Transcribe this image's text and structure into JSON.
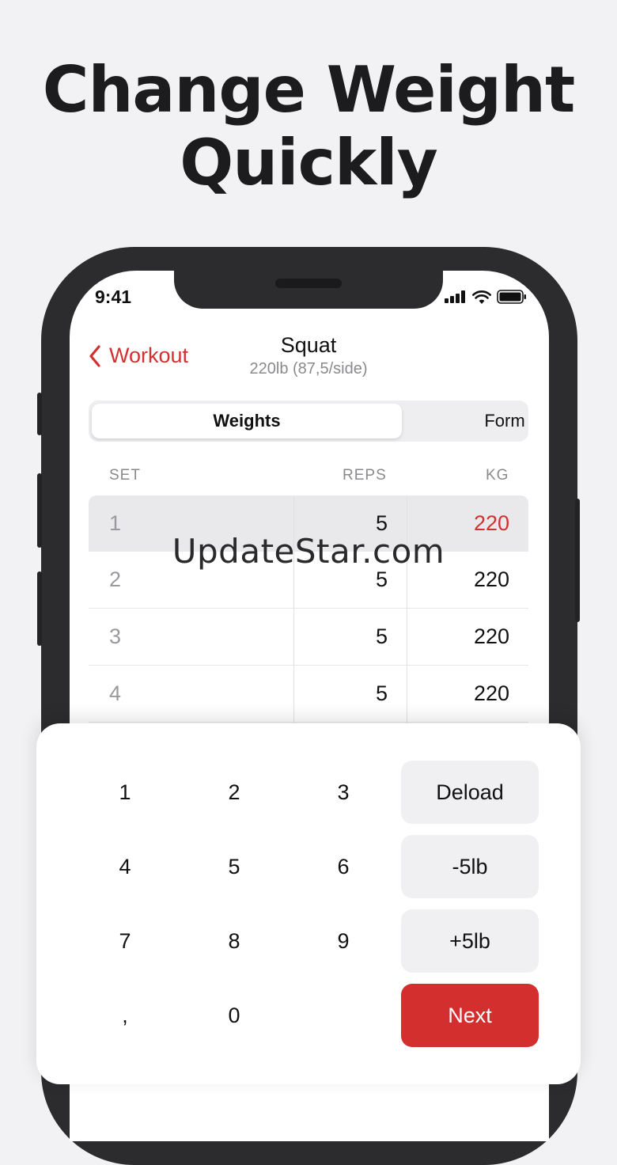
{
  "headline": {
    "line1": "Change Weight",
    "line2": "Quickly"
  },
  "status": {
    "time": "9:41"
  },
  "nav": {
    "back_label": "Workout",
    "title": "Squat",
    "subtitle": "220lb (87,5/side)"
  },
  "tabs": [
    {
      "label": "Weights",
      "selected": true
    },
    {
      "label": "Form",
      "selected": false
    }
  ],
  "table": {
    "headers": {
      "set": "SET",
      "reps": "REPS",
      "kg": "KG"
    },
    "rows": [
      {
        "set": "1",
        "reps": "5",
        "kg": "220",
        "selected": true
      },
      {
        "set": "2",
        "reps": "5",
        "kg": "220"
      },
      {
        "set": "3",
        "reps": "5",
        "kg": "220"
      },
      {
        "set": "4",
        "reps": "5",
        "kg": "220"
      }
    ]
  },
  "watermark": "UpdateStar.com",
  "keypad": {
    "keys": [
      "1",
      "2",
      "3",
      "4",
      "5",
      "6",
      "7",
      "8",
      "9",
      ",",
      "0"
    ],
    "actions": {
      "deload": "Deload",
      "minus": "-5lb",
      "plus": "+5lb",
      "next": "Next"
    }
  },
  "colors": {
    "accent": "#d3312f",
    "background": "#f2f2f4",
    "phone": "#2c2c2e"
  },
  "icons": [
    "chevron-left-icon",
    "signal-icon",
    "wifi-icon",
    "battery-icon"
  ]
}
